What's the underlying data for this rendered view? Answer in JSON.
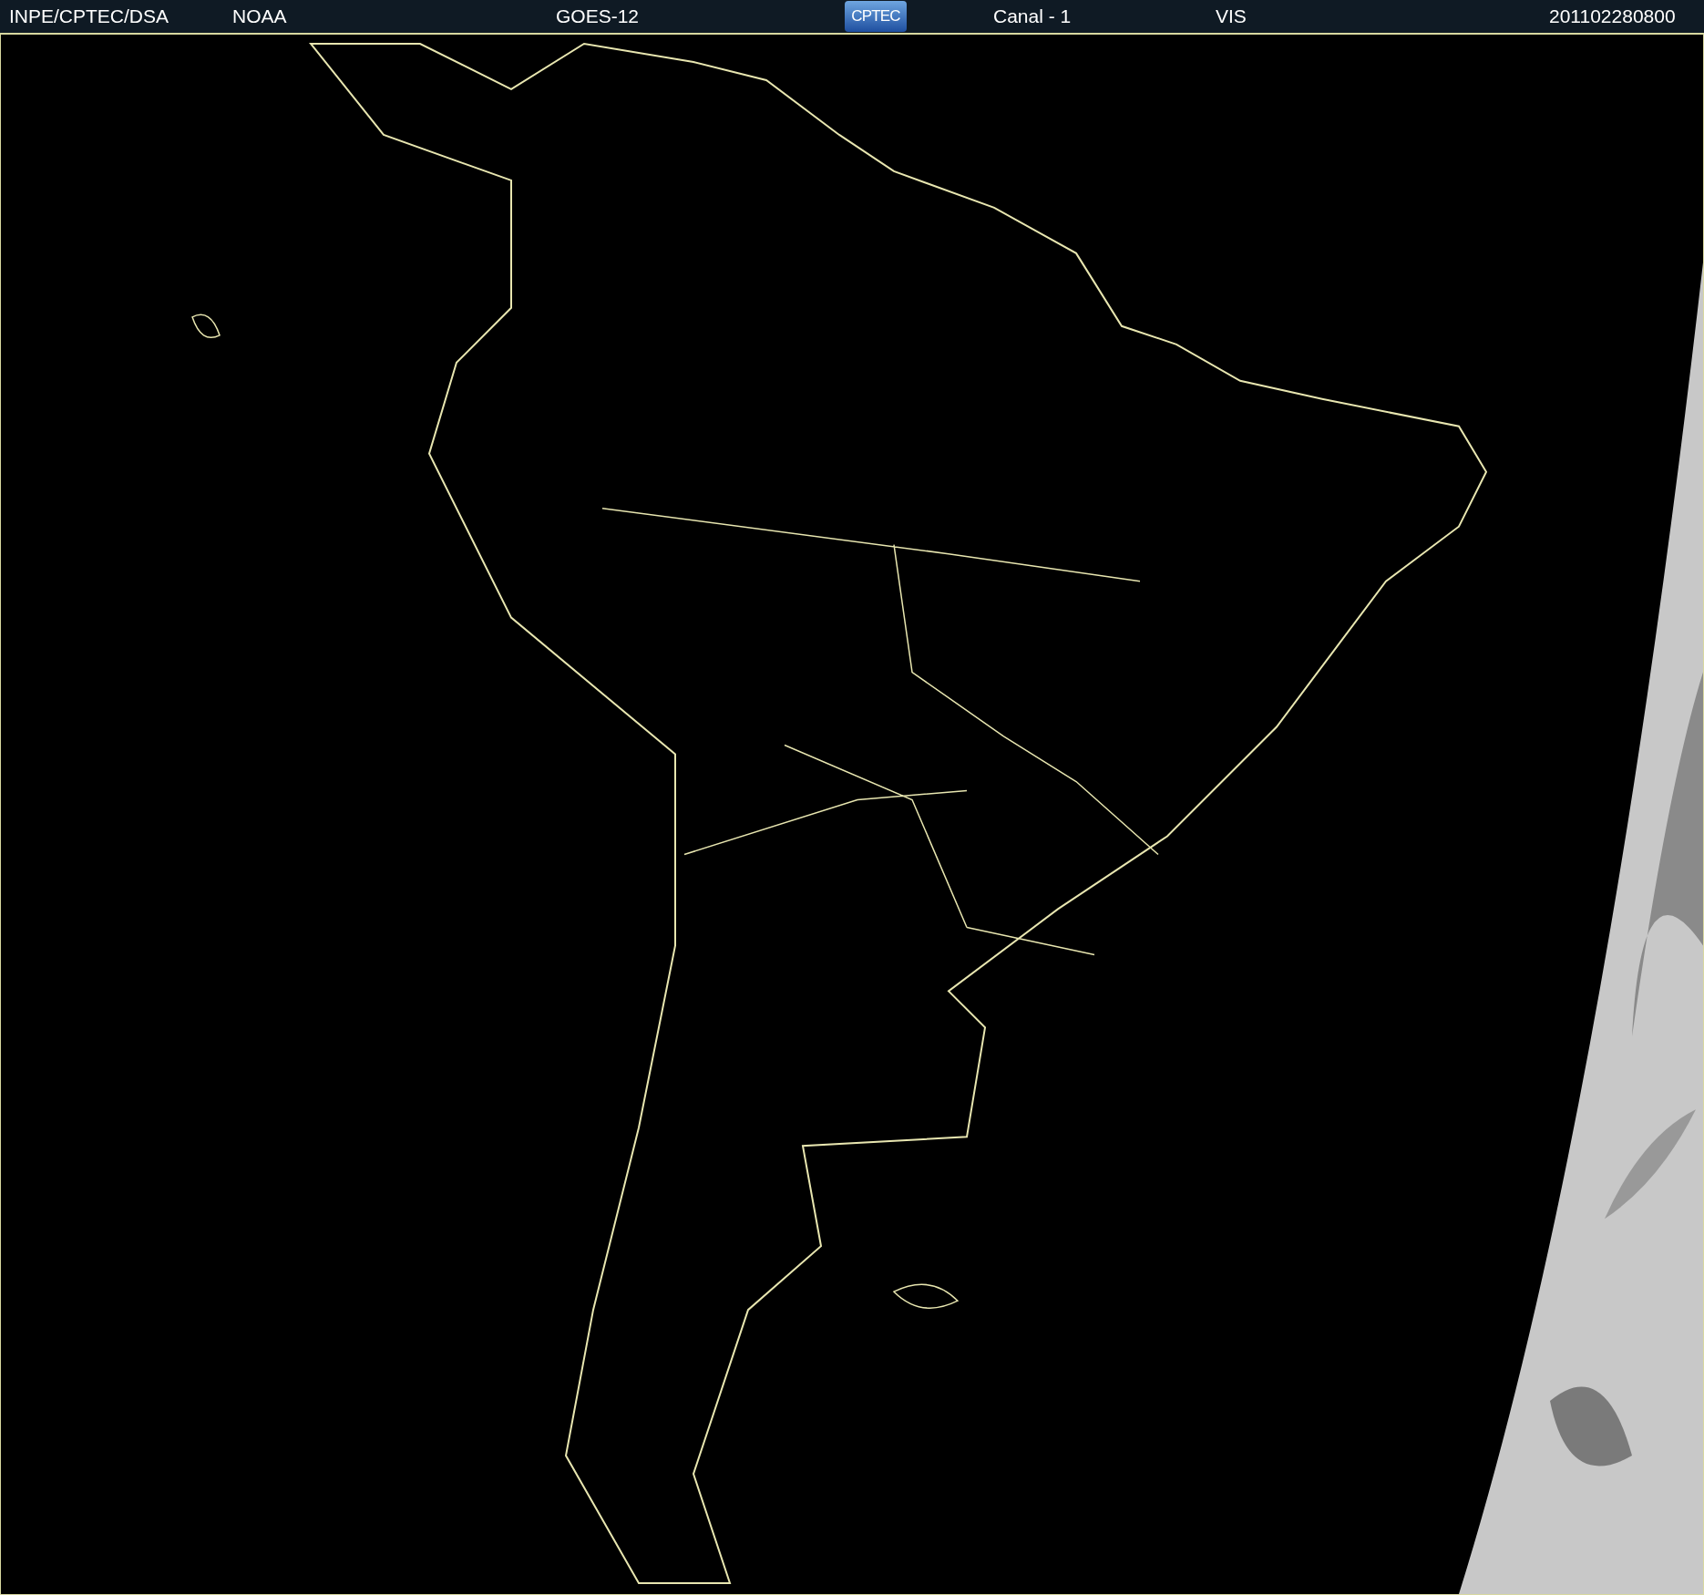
{
  "header": {
    "items": [
      {
        "kind": "text",
        "text": "INPE/CPTEC/DSA"
      },
      {
        "kind": "text",
        "text": "NOAA"
      },
      {
        "kind": "text",
        "text": "GOES-12"
      },
      {
        "kind": "logo",
        "text": "CPTEC"
      },
      {
        "kind": "text",
        "text": "Canal - 1"
      },
      {
        "kind": "text",
        "text": "VIS"
      },
      {
        "kind": "text",
        "text": "201102280800"
      }
    ]
  }
}
